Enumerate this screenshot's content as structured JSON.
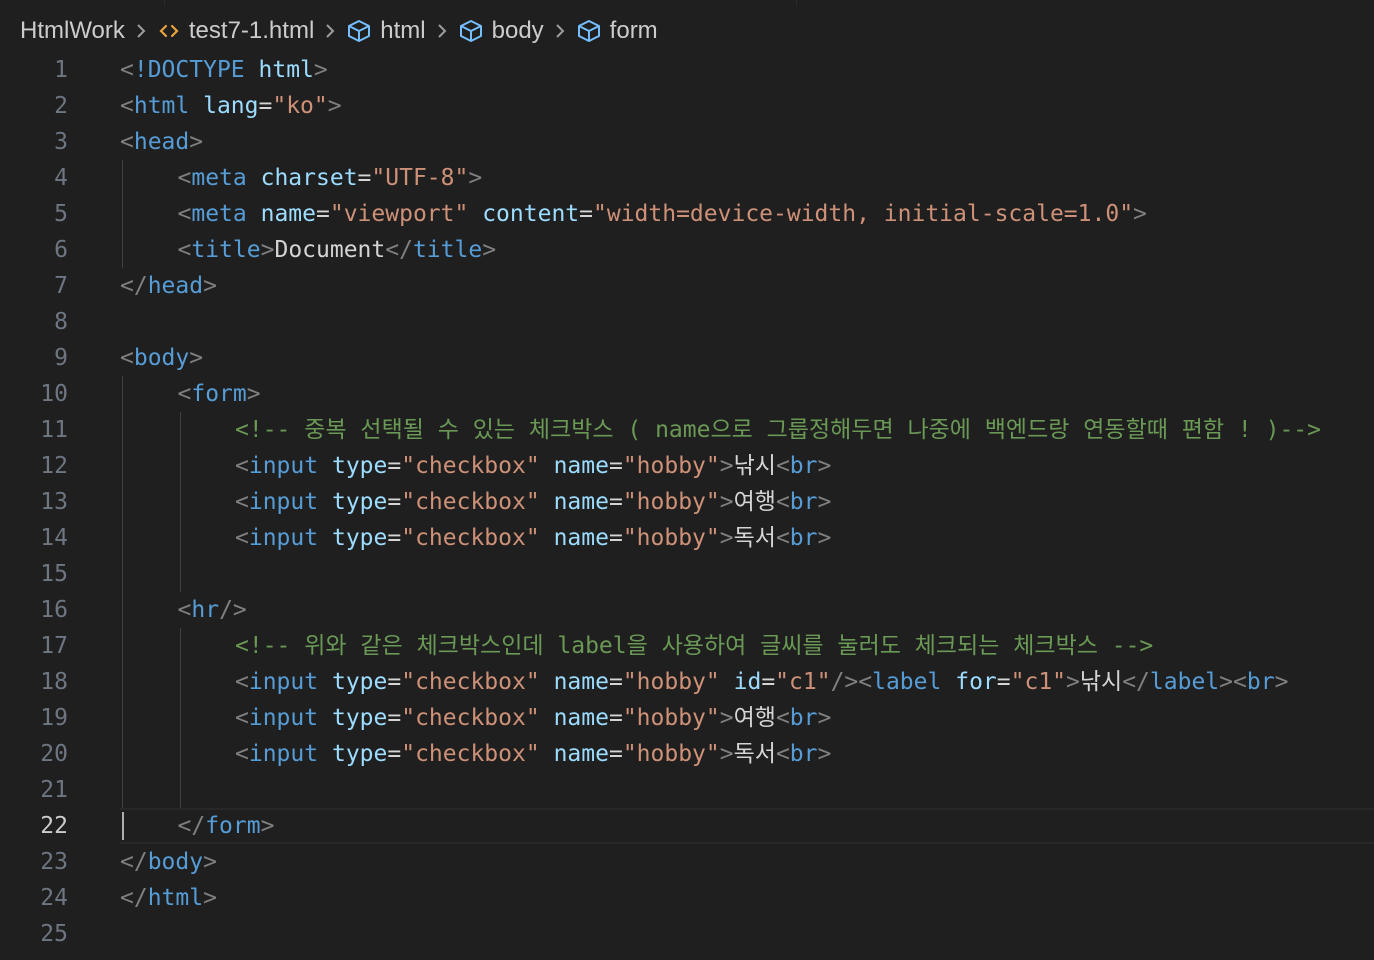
{
  "breadcrumb": {
    "folder": "HtmlWork",
    "file": "test7-1.html",
    "nodes": [
      "html",
      "body",
      "form"
    ],
    "icons": {
      "file": "html-file-icon",
      "node": "element-cube-icon",
      "separator": "chevron-right-icon"
    }
  },
  "editor": {
    "current_line": 22,
    "colors": {
      "background": "#1f1f1f",
      "punctuation": "#808080",
      "tag": "#569cd6",
      "attribute": "#9cdcfe",
      "string": "#ce9178",
      "text": "#d4d4d4",
      "comment": "#6a9955",
      "line_number": "#6e7681"
    },
    "lines": [
      {
        "n": "1",
        "indent": 0,
        "tokens": [
          [
            "p",
            "<"
          ],
          [
            "tag",
            "!DOCTYPE"
          ],
          [
            "t",
            " "
          ],
          [
            "attr",
            "html"
          ],
          [
            "p",
            ">"
          ]
        ]
      },
      {
        "n": "2",
        "indent": 0,
        "tokens": [
          [
            "p",
            "<"
          ],
          [
            "tag",
            "html"
          ],
          [
            "t",
            " "
          ],
          [
            "attr",
            "lang"
          ],
          [
            "eq",
            "="
          ],
          [
            "str",
            "\"ko\""
          ],
          [
            "p",
            ">"
          ]
        ]
      },
      {
        "n": "3",
        "indent": 0,
        "tokens": [
          [
            "p",
            "<"
          ],
          [
            "tag",
            "head"
          ],
          [
            "p",
            ">"
          ]
        ]
      },
      {
        "n": "4",
        "indent": 1,
        "tokens": [
          [
            "p",
            "<"
          ],
          [
            "tag",
            "meta"
          ],
          [
            "t",
            " "
          ],
          [
            "attr",
            "charset"
          ],
          [
            "eq",
            "="
          ],
          [
            "str",
            "\"UTF-8\""
          ],
          [
            "p",
            ">"
          ]
        ]
      },
      {
        "n": "5",
        "indent": 1,
        "tokens": [
          [
            "p",
            "<"
          ],
          [
            "tag",
            "meta"
          ],
          [
            "t",
            " "
          ],
          [
            "attr",
            "name"
          ],
          [
            "eq",
            "="
          ],
          [
            "str",
            "\"viewport\""
          ],
          [
            "t",
            " "
          ],
          [
            "attr",
            "content"
          ],
          [
            "eq",
            "="
          ],
          [
            "str",
            "\"width=device-width, initial-scale=1.0\""
          ],
          [
            "p",
            ">"
          ]
        ]
      },
      {
        "n": "6",
        "indent": 1,
        "tokens": [
          [
            "p",
            "<"
          ],
          [
            "tag",
            "title"
          ],
          [
            "p",
            ">"
          ],
          [
            "t",
            "Document"
          ],
          [
            "p",
            "</"
          ],
          [
            "tag",
            "title"
          ],
          [
            "p",
            ">"
          ]
        ]
      },
      {
        "n": "7",
        "indent": 0,
        "tokens": [
          [
            "p",
            "</"
          ],
          [
            "tag",
            "head"
          ],
          [
            "p",
            ">"
          ]
        ]
      },
      {
        "n": "8",
        "indent": 0,
        "tokens": []
      },
      {
        "n": "9",
        "indent": 0,
        "tokens": [
          [
            "p",
            "<"
          ],
          [
            "tag",
            "body"
          ],
          [
            "p",
            ">"
          ]
        ]
      },
      {
        "n": "10",
        "indent": 1,
        "tokens": [
          [
            "p",
            "<"
          ],
          [
            "tag",
            "form"
          ],
          [
            "p",
            ">"
          ]
        ]
      },
      {
        "n": "11",
        "indent": 2,
        "tokens": [
          [
            "com",
            "<!-- 중복 선택될 수 있는 체크박스 ( name으로 그룹정해두면 나중에 백엔드랑 연동할때 편함 ! )-->"
          ]
        ]
      },
      {
        "n": "12",
        "indent": 2,
        "tokens": [
          [
            "p",
            "<"
          ],
          [
            "tag",
            "input"
          ],
          [
            "t",
            " "
          ],
          [
            "attr",
            "type"
          ],
          [
            "eq",
            "="
          ],
          [
            "str",
            "\"checkbox\""
          ],
          [
            "t",
            " "
          ],
          [
            "attr",
            "name"
          ],
          [
            "eq",
            "="
          ],
          [
            "str",
            "\"hobby\""
          ],
          [
            "p",
            ">"
          ],
          [
            "t",
            "낚시"
          ],
          [
            "p",
            "<"
          ],
          [
            "tag",
            "br"
          ],
          [
            "p",
            ">"
          ]
        ]
      },
      {
        "n": "13",
        "indent": 2,
        "tokens": [
          [
            "p",
            "<"
          ],
          [
            "tag",
            "input"
          ],
          [
            "t",
            " "
          ],
          [
            "attr",
            "type"
          ],
          [
            "eq",
            "="
          ],
          [
            "str",
            "\"checkbox\""
          ],
          [
            "t",
            " "
          ],
          [
            "attr",
            "name"
          ],
          [
            "eq",
            "="
          ],
          [
            "str",
            "\"hobby\""
          ],
          [
            "p",
            ">"
          ],
          [
            "t",
            "여행"
          ],
          [
            "p",
            "<"
          ],
          [
            "tag",
            "br"
          ],
          [
            "p",
            ">"
          ]
        ]
      },
      {
        "n": "14",
        "indent": 2,
        "tokens": [
          [
            "p",
            "<"
          ],
          [
            "tag",
            "input"
          ],
          [
            "t",
            " "
          ],
          [
            "attr",
            "type"
          ],
          [
            "eq",
            "="
          ],
          [
            "str",
            "\"checkbox\""
          ],
          [
            "t",
            " "
          ],
          [
            "attr",
            "name"
          ],
          [
            "eq",
            "="
          ],
          [
            "str",
            "\"hobby\""
          ],
          [
            "p",
            ">"
          ],
          [
            "t",
            "독서"
          ],
          [
            "p",
            "<"
          ],
          [
            "tag",
            "br"
          ],
          [
            "p",
            ">"
          ]
        ]
      },
      {
        "n": "15",
        "indent": 0,
        "tokens": []
      },
      {
        "n": "16",
        "indent": 1,
        "tokens": [
          [
            "p",
            "<"
          ],
          [
            "tag",
            "hr"
          ],
          [
            "p",
            "/>"
          ]
        ]
      },
      {
        "n": "17",
        "indent": 2,
        "tokens": [
          [
            "com",
            "<!-- 위와 같은 체크박스인데 label을 사용하여 글씨를 눌러도 체크되는 체크박스 -->"
          ]
        ]
      },
      {
        "n": "18",
        "indent": 2,
        "tokens": [
          [
            "p",
            "<"
          ],
          [
            "tag",
            "input"
          ],
          [
            "t",
            " "
          ],
          [
            "attr",
            "type"
          ],
          [
            "eq",
            "="
          ],
          [
            "str",
            "\"checkbox\""
          ],
          [
            "t",
            " "
          ],
          [
            "attr",
            "name"
          ],
          [
            "eq",
            "="
          ],
          [
            "str",
            "\"hobby\""
          ],
          [
            "t",
            " "
          ],
          [
            "attr",
            "id"
          ],
          [
            "eq",
            "="
          ],
          [
            "str",
            "\"c1\""
          ],
          [
            "p",
            "/><"
          ],
          [
            "tag",
            "label"
          ],
          [
            "t",
            " "
          ],
          [
            "attr",
            "for"
          ],
          [
            "eq",
            "="
          ],
          [
            "str",
            "\"c1\""
          ],
          [
            "p",
            ">"
          ],
          [
            "t",
            "낚시"
          ],
          [
            "p",
            "</"
          ],
          [
            "tag",
            "label"
          ],
          [
            "p",
            "><"
          ],
          [
            "tag",
            "br"
          ],
          [
            "p",
            ">"
          ]
        ]
      },
      {
        "n": "19",
        "indent": 2,
        "tokens": [
          [
            "p",
            "<"
          ],
          [
            "tag",
            "input"
          ],
          [
            "t",
            " "
          ],
          [
            "attr",
            "type"
          ],
          [
            "eq",
            "="
          ],
          [
            "str",
            "\"checkbox\""
          ],
          [
            "t",
            " "
          ],
          [
            "attr",
            "name"
          ],
          [
            "eq",
            "="
          ],
          [
            "str",
            "\"hobby\""
          ],
          [
            "p",
            ">"
          ],
          [
            "t",
            "여행"
          ],
          [
            "p",
            "<"
          ],
          [
            "tag",
            "br"
          ],
          [
            "p",
            ">"
          ]
        ]
      },
      {
        "n": "20",
        "indent": 2,
        "tokens": [
          [
            "p",
            "<"
          ],
          [
            "tag",
            "input"
          ],
          [
            "t",
            " "
          ],
          [
            "attr",
            "type"
          ],
          [
            "eq",
            "="
          ],
          [
            "str",
            "\"checkbox\""
          ],
          [
            "t",
            " "
          ],
          [
            "attr",
            "name"
          ],
          [
            "eq",
            "="
          ],
          [
            "str",
            "\"hobby\""
          ],
          [
            "p",
            ">"
          ],
          [
            "t",
            "독서"
          ],
          [
            "p",
            "<"
          ],
          [
            "tag",
            "br"
          ],
          [
            "p",
            ">"
          ]
        ]
      },
      {
        "n": "21",
        "indent": 0,
        "tokens": []
      },
      {
        "n": "22",
        "indent": 1,
        "tokens": [
          [
            "p",
            "</"
          ],
          [
            "tag",
            "form"
          ],
          [
            "p",
            ">"
          ]
        ]
      },
      {
        "n": "23",
        "indent": 0,
        "tokens": [
          [
            "p",
            "</"
          ],
          [
            "tag",
            "body"
          ],
          [
            "p",
            ">"
          ]
        ]
      },
      {
        "n": "24",
        "indent": 0,
        "tokens": [
          [
            "p",
            "</"
          ],
          [
            "tag",
            "html"
          ],
          [
            "p",
            ">"
          ]
        ]
      },
      {
        "n": "25",
        "indent": 0,
        "tokens": []
      }
    ]
  }
}
